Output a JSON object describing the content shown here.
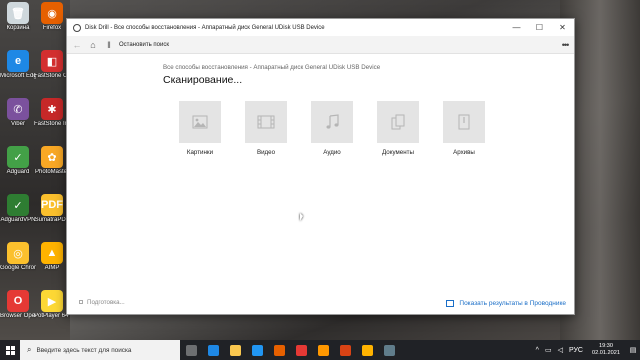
{
  "desktop": {
    "icons": [
      {
        "label": "Корзина",
        "color": "#cfd8dc",
        "glyph": "🗑",
        "icon": "recycle-bin-icon"
      },
      {
        "label": "Firefox",
        "color": "#e66000",
        "glyph": "◉",
        "icon": "firefox-icon"
      },
      {
        "label": "Microsoft Edge",
        "color": "#1e88e5",
        "glyph": "e",
        "icon": "edge-icon"
      },
      {
        "label": "FastStone Capture",
        "color": "#d32f2f",
        "glyph": "◧",
        "icon": "faststone-icon"
      },
      {
        "label": "Viber",
        "color": "#7b519d",
        "glyph": "✆",
        "icon": "viber-icon"
      },
      {
        "label": "FastStone Image Viewer",
        "color": "#c62828",
        "glyph": "✱",
        "icon": "image-viewer-icon"
      },
      {
        "label": "Adguard",
        "color": "#43a047",
        "glyph": "✓",
        "icon": "adguard-icon"
      },
      {
        "label": "PhotoMaster",
        "color": "#f9a825",
        "glyph": "✿",
        "icon": "photomaster-icon"
      },
      {
        "label": "AdguardVPN",
        "color": "#2e7d32",
        "glyph": "✓",
        "icon": "adguard-vpn-icon"
      },
      {
        "label": "SumatraPDF",
        "color": "#fbc02d",
        "glyph": "PDF",
        "icon": "sumatra-icon"
      },
      {
        "label": "Google Chrome",
        "color": "#fbc02d",
        "glyph": "◎",
        "icon": "chrome-icon"
      },
      {
        "label": "AIMP",
        "color": "#ffb300",
        "glyph": "▲",
        "icon": "aimp-icon"
      },
      {
        "label": "Browser Opera",
        "color": "#e53935",
        "glyph": "O",
        "icon": "opera-icon"
      },
      {
        "label": "PotPlayer 64 bit",
        "color": "#fdd835",
        "glyph": "▶",
        "icon": "potplayer-icon"
      }
    ]
  },
  "window": {
    "title": "Disk Drill - Все способы восстановления - Аппаратный диск General UDisk USB Device",
    "minimize_glyph": "—",
    "maximize_glyph": "☐",
    "close_glyph": "✕",
    "toolbar": {
      "back_glyph": "←",
      "home_glyph": "⌂",
      "pause_glyph": "‖",
      "stop_label": "Остановить поиск",
      "more_glyph": "•••"
    },
    "breadcrumb": "Все способы восстановления - Аппаратный диск General UDisk USB Device",
    "heading": "Сканирование...",
    "categories": [
      {
        "label": "Картинки"
      },
      {
        "label": "Видео"
      },
      {
        "label": "Аудио"
      },
      {
        "label": "Документы"
      },
      {
        "label": "Архивы"
      }
    ],
    "status": "Подготовка...",
    "show_results": "Показать результаты в Проводнике"
  },
  "taskbar": {
    "search_placeholder": "Введите здесь текст для поиска",
    "apps": [
      {
        "icon": "task-view-icon",
        "color": "#ffffff"
      },
      {
        "icon": "edge-taskbar-icon",
        "color": "#1e88e5"
      },
      {
        "icon": "explorer-icon",
        "color": "#f9c74f"
      },
      {
        "icon": "store-icon",
        "color": "#2196f3"
      },
      {
        "icon": "firefox-taskbar-icon",
        "color": "#e66000"
      },
      {
        "icon": "opera-taskbar-icon",
        "color": "#e53935"
      },
      {
        "icon": "notes-icon",
        "color": "#ff9800"
      },
      {
        "icon": "app-icon",
        "color": "#d84315"
      },
      {
        "icon": "aimp-taskbar-icon",
        "color": "#ffb300"
      },
      {
        "icon": "diskdrill-taskbar-icon",
        "color": "#607d8b"
      }
    ],
    "lang": "РУС",
    "time": "19:30",
    "date": "02.01.2021"
  }
}
